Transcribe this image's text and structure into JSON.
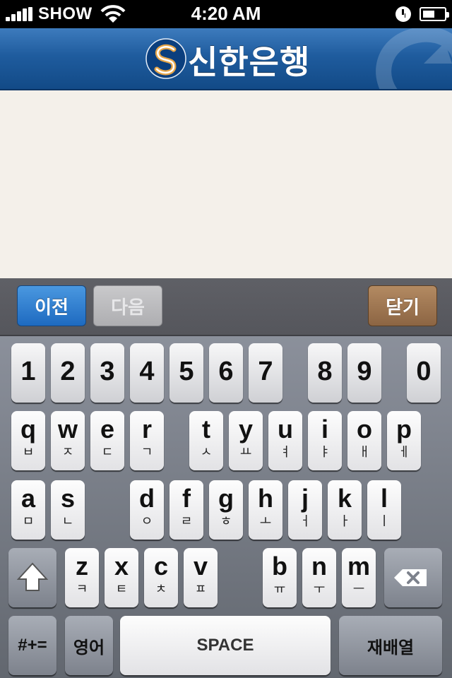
{
  "status_bar": {
    "carrier": "SHOW",
    "time": "4:20 AM"
  },
  "header": {
    "title": "신한은행"
  },
  "toolbar": {
    "prev_label": "이전",
    "next_label": "다음",
    "close_label": "닫기"
  },
  "keyboard": {
    "number_row": [
      "1",
      "2",
      "3",
      "4",
      "5",
      "6",
      "7",
      "8",
      "9",
      "0"
    ],
    "row1": [
      {
        "key": "q",
        "sub": "ㅂ"
      },
      {
        "key": "w",
        "sub": "ㅈ"
      },
      {
        "key": "e",
        "sub": "ㄷ"
      },
      {
        "key": "r",
        "sub": "ㄱ"
      },
      {
        "key": "t",
        "sub": "ㅅ"
      },
      {
        "key": "y",
        "sub": "ㅛ"
      },
      {
        "key": "u",
        "sub": "ㅕ"
      },
      {
        "key": "i",
        "sub": "ㅑ"
      },
      {
        "key": "o",
        "sub": "ㅐ"
      },
      {
        "key": "p",
        "sub": "ㅔ"
      }
    ],
    "row2": [
      {
        "key": "a",
        "sub": "ㅁ"
      },
      {
        "key": "s",
        "sub": "ㄴ"
      },
      {
        "key": "d",
        "sub": "ㅇ"
      },
      {
        "key": "f",
        "sub": "ㄹ"
      },
      {
        "key": "g",
        "sub": "ㅎ"
      },
      {
        "key": "h",
        "sub": "ㅗ"
      },
      {
        "key": "j",
        "sub": "ㅓ"
      },
      {
        "key": "k",
        "sub": "ㅏ"
      },
      {
        "key": "l",
        "sub": "ㅣ"
      }
    ],
    "row3": [
      {
        "key": "z",
        "sub": "ㅋ"
      },
      {
        "key": "x",
        "sub": "ㅌ"
      },
      {
        "key": "c",
        "sub": "ㅊ"
      },
      {
        "key": "v",
        "sub": "ㅍ"
      },
      {
        "key": "b",
        "sub": "ㅠ"
      },
      {
        "key": "n",
        "sub": "ㅜ"
      },
      {
        "key": "m",
        "sub": "ㅡ"
      }
    ],
    "symbols_label": "#+=",
    "language_label": "영어",
    "space_label": "SPACE",
    "rearrange_label": "재배열"
  }
}
